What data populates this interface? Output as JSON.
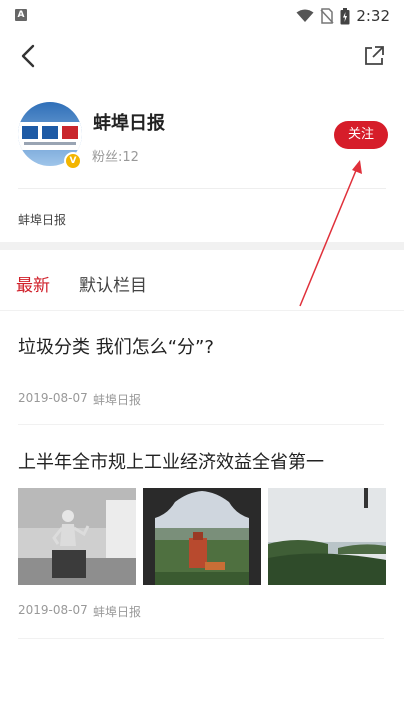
{
  "status_bar": {
    "time": "2:32",
    "app_badge": "A"
  },
  "profile": {
    "name": "蚌埠日报",
    "fans": "粉丝:12",
    "follow_label": "关注",
    "description": "蚌埠日报",
    "avatar_text": "蚌埠日报"
  },
  "tabs": [
    {
      "label": "最新",
      "active": true
    },
    {
      "label": "默认栏目",
      "active": false
    }
  ],
  "articles": [
    {
      "title": "垃圾分类 我们怎么“分”?",
      "date": "2019-08-07",
      "source": "蚌埠日报"
    },
    {
      "title": "上半年全市规上工业经济效益全省第一",
      "date": "2019-08-07",
      "source": "蚌埠日报"
    }
  ],
  "colors": {
    "accent": "#d61d2a",
    "tab_active": "#d0202a",
    "annotation_arrow": "#e0303a"
  }
}
